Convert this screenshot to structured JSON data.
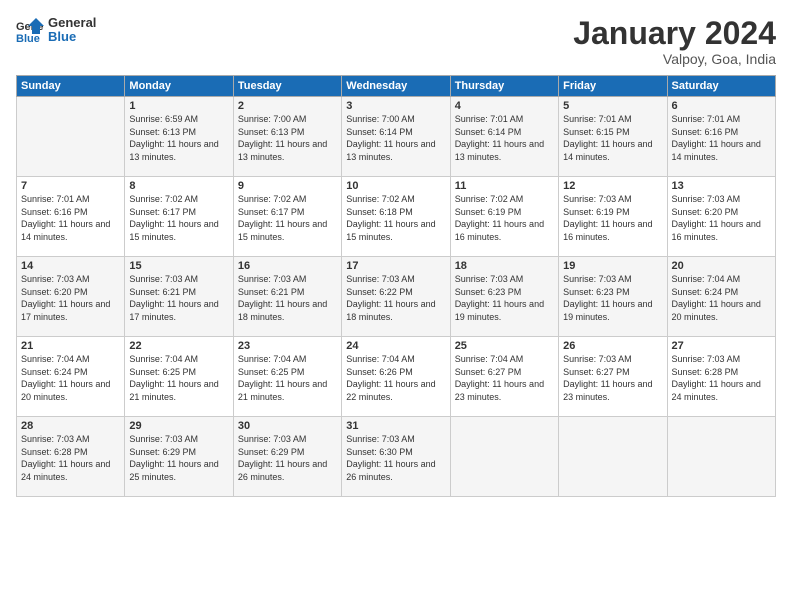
{
  "header": {
    "logo_line1": "General",
    "logo_line2": "Blue",
    "month_title": "January 2024",
    "subtitle": "Valpoy, Goa, India"
  },
  "weekdays": [
    "Sunday",
    "Monday",
    "Tuesday",
    "Wednesday",
    "Thursday",
    "Friday",
    "Saturday"
  ],
  "weeks": [
    [
      {
        "day": "",
        "sunrise": "",
        "sunset": "",
        "daylight": ""
      },
      {
        "day": "1",
        "sunrise": "Sunrise: 6:59 AM",
        "sunset": "Sunset: 6:13 PM",
        "daylight": "Daylight: 11 hours and 13 minutes."
      },
      {
        "day": "2",
        "sunrise": "Sunrise: 7:00 AM",
        "sunset": "Sunset: 6:13 PM",
        "daylight": "Daylight: 11 hours and 13 minutes."
      },
      {
        "day": "3",
        "sunrise": "Sunrise: 7:00 AM",
        "sunset": "Sunset: 6:14 PM",
        "daylight": "Daylight: 11 hours and 13 minutes."
      },
      {
        "day": "4",
        "sunrise": "Sunrise: 7:01 AM",
        "sunset": "Sunset: 6:14 PM",
        "daylight": "Daylight: 11 hours and 13 minutes."
      },
      {
        "day": "5",
        "sunrise": "Sunrise: 7:01 AM",
        "sunset": "Sunset: 6:15 PM",
        "daylight": "Daylight: 11 hours and 14 minutes."
      },
      {
        "day": "6",
        "sunrise": "Sunrise: 7:01 AM",
        "sunset": "Sunset: 6:16 PM",
        "daylight": "Daylight: 11 hours and 14 minutes."
      }
    ],
    [
      {
        "day": "7",
        "sunrise": "Sunrise: 7:01 AM",
        "sunset": "Sunset: 6:16 PM",
        "daylight": "Daylight: 11 hours and 14 minutes."
      },
      {
        "day": "8",
        "sunrise": "Sunrise: 7:02 AM",
        "sunset": "Sunset: 6:17 PM",
        "daylight": "Daylight: 11 hours and 15 minutes."
      },
      {
        "day": "9",
        "sunrise": "Sunrise: 7:02 AM",
        "sunset": "Sunset: 6:17 PM",
        "daylight": "Daylight: 11 hours and 15 minutes."
      },
      {
        "day": "10",
        "sunrise": "Sunrise: 7:02 AM",
        "sunset": "Sunset: 6:18 PM",
        "daylight": "Daylight: 11 hours and 15 minutes."
      },
      {
        "day": "11",
        "sunrise": "Sunrise: 7:02 AM",
        "sunset": "Sunset: 6:19 PM",
        "daylight": "Daylight: 11 hours and 16 minutes."
      },
      {
        "day": "12",
        "sunrise": "Sunrise: 7:03 AM",
        "sunset": "Sunset: 6:19 PM",
        "daylight": "Daylight: 11 hours and 16 minutes."
      },
      {
        "day": "13",
        "sunrise": "Sunrise: 7:03 AM",
        "sunset": "Sunset: 6:20 PM",
        "daylight": "Daylight: 11 hours and 16 minutes."
      }
    ],
    [
      {
        "day": "14",
        "sunrise": "Sunrise: 7:03 AM",
        "sunset": "Sunset: 6:20 PM",
        "daylight": "Daylight: 11 hours and 17 minutes."
      },
      {
        "day": "15",
        "sunrise": "Sunrise: 7:03 AM",
        "sunset": "Sunset: 6:21 PM",
        "daylight": "Daylight: 11 hours and 17 minutes."
      },
      {
        "day": "16",
        "sunrise": "Sunrise: 7:03 AM",
        "sunset": "Sunset: 6:21 PM",
        "daylight": "Daylight: 11 hours and 18 minutes."
      },
      {
        "day": "17",
        "sunrise": "Sunrise: 7:03 AM",
        "sunset": "Sunset: 6:22 PM",
        "daylight": "Daylight: 11 hours and 18 minutes."
      },
      {
        "day": "18",
        "sunrise": "Sunrise: 7:03 AM",
        "sunset": "Sunset: 6:23 PM",
        "daylight": "Daylight: 11 hours and 19 minutes."
      },
      {
        "day": "19",
        "sunrise": "Sunrise: 7:03 AM",
        "sunset": "Sunset: 6:23 PM",
        "daylight": "Daylight: 11 hours and 19 minutes."
      },
      {
        "day": "20",
        "sunrise": "Sunrise: 7:04 AM",
        "sunset": "Sunset: 6:24 PM",
        "daylight": "Daylight: 11 hours and 20 minutes."
      }
    ],
    [
      {
        "day": "21",
        "sunrise": "Sunrise: 7:04 AM",
        "sunset": "Sunset: 6:24 PM",
        "daylight": "Daylight: 11 hours and 20 minutes."
      },
      {
        "day": "22",
        "sunrise": "Sunrise: 7:04 AM",
        "sunset": "Sunset: 6:25 PM",
        "daylight": "Daylight: 11 hours and 21 minutes."
      },
      {
        "day": "23",
        "sunrise": "Sunrise: 7:04 AM",
        "sunset": "Sunset: 6:25 PM",
        "daylight": "Daylight: 11 hours and 21 minutes."
      },
      {
        "day": "24",
        "sunrise": "Sunrise: 7:04 AM",
        "sunset": "Sunset: 6:26 PM",
        "daylight": "Daylight: 11 hours and 22 minutes."
      },
      {
        "day": "25",
        "sunrise": "Sunrise: 7:04 AM",
        "sunset": "Sunset: 6:27 PM",
        "daylight": "Daylight: 11 hours and 23 minutes."
      },
      {
        "day": "26",
        "sunrise": "Sunrise: 7:03 AM",
        "sunset": "Sunset: 6:27 PM",
        "daylight": "Daylight: 11 hours and 23 minutes."
      },
      {
        "day": "27",
        "sunrise": "Sunrise: 7:03 AM",
        "sunset": "Sunset: 6:28 PM",
        "daylight": "Daylight: 11 hours and 24 minutes."
      }
    ],
    [
      {
        "day": "28",
        "sunrise": "Sunrise: 7:03 AM",
        "sunset": "Sunset: 6:28 PM",
        "daylight": "Daylight: 11 hours and 24 minutes."
      },
      {
        "day": "29",
        "sunrise": "Sunrise: 7:03 AM",
        "sunset": "Sunset: 6:29 PM",
        "daylight": "Daylight: 11 hours and 25 minutes."
      },
      {
        "day": "30",
        "sunrise": "Sunrise: 7:03 AM",
        "sunset": "Sunset: 6:29 PM",
        "daylight": "Daylight: 11 hours and 26 minutes."
      },
      {
        "day": "31",
        "sunrise": "Sunrise: 7:03 AM",
        "sunset": "Sunset: 6:30 PM",
        "daylight": "Daylight: 11 hours and 26 minutes."
      },
      {
        "day": "",
        "sunrise": "",
        "sunset": "",
        "daylight": ""
      },
      {
        "day": "",
        "sunrise": "",
        "sunset": "",
        "daylight": ""
      },
      {
        "day": "",
        "sunrise": "",
        "sunset": "",
        "daylight": ""
      }
    ]
  ]
}
